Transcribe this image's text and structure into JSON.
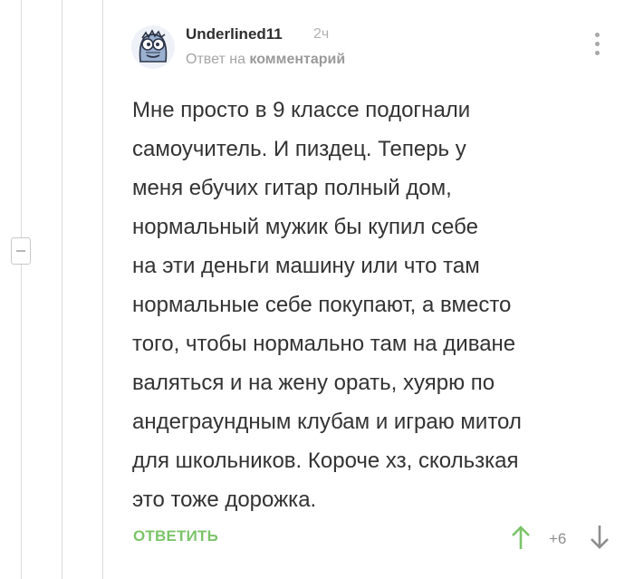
{
  "comment": {
    "author": "Underlined11",
    "time": "2ч",
    "reply_to_prefix": "Ответ на",
    "reply_to_link": "комментарий",
    "text": "Мне просто в 9 классе подогнали\nсамоучитель. И пиздец. Теперь у\nменя ебучих гитар полный дом,\nнормальный мужик бы купил себе\nна эти деньги машину или что там\nнормальные себе покупают, а вместо\nтого, чтобы нормально там на диване\nваляться и на жену орать, хуярю по\nандеграундным клубам и играю митол\nдля школьников. Короче хз, скользкая\nэто тоже дорожка.",
    "reply_button_label": "ОТВЕТИТЬ",
    "rating": "+6"
  },
  "icons": {
    "avatar": "cartoon-face-avatar",
    "more": "vertical-dots-icon",
    "collapse": "minus-collapse-icon",
    "upvote": "arrow-up-icon",
    "downvote": "arrow-down-icon"
  },
  "colors": {
    "accent_green": "#7cc46a",
    "text": "#333333",
    "muted": "#a5a5a5"
  }
}
